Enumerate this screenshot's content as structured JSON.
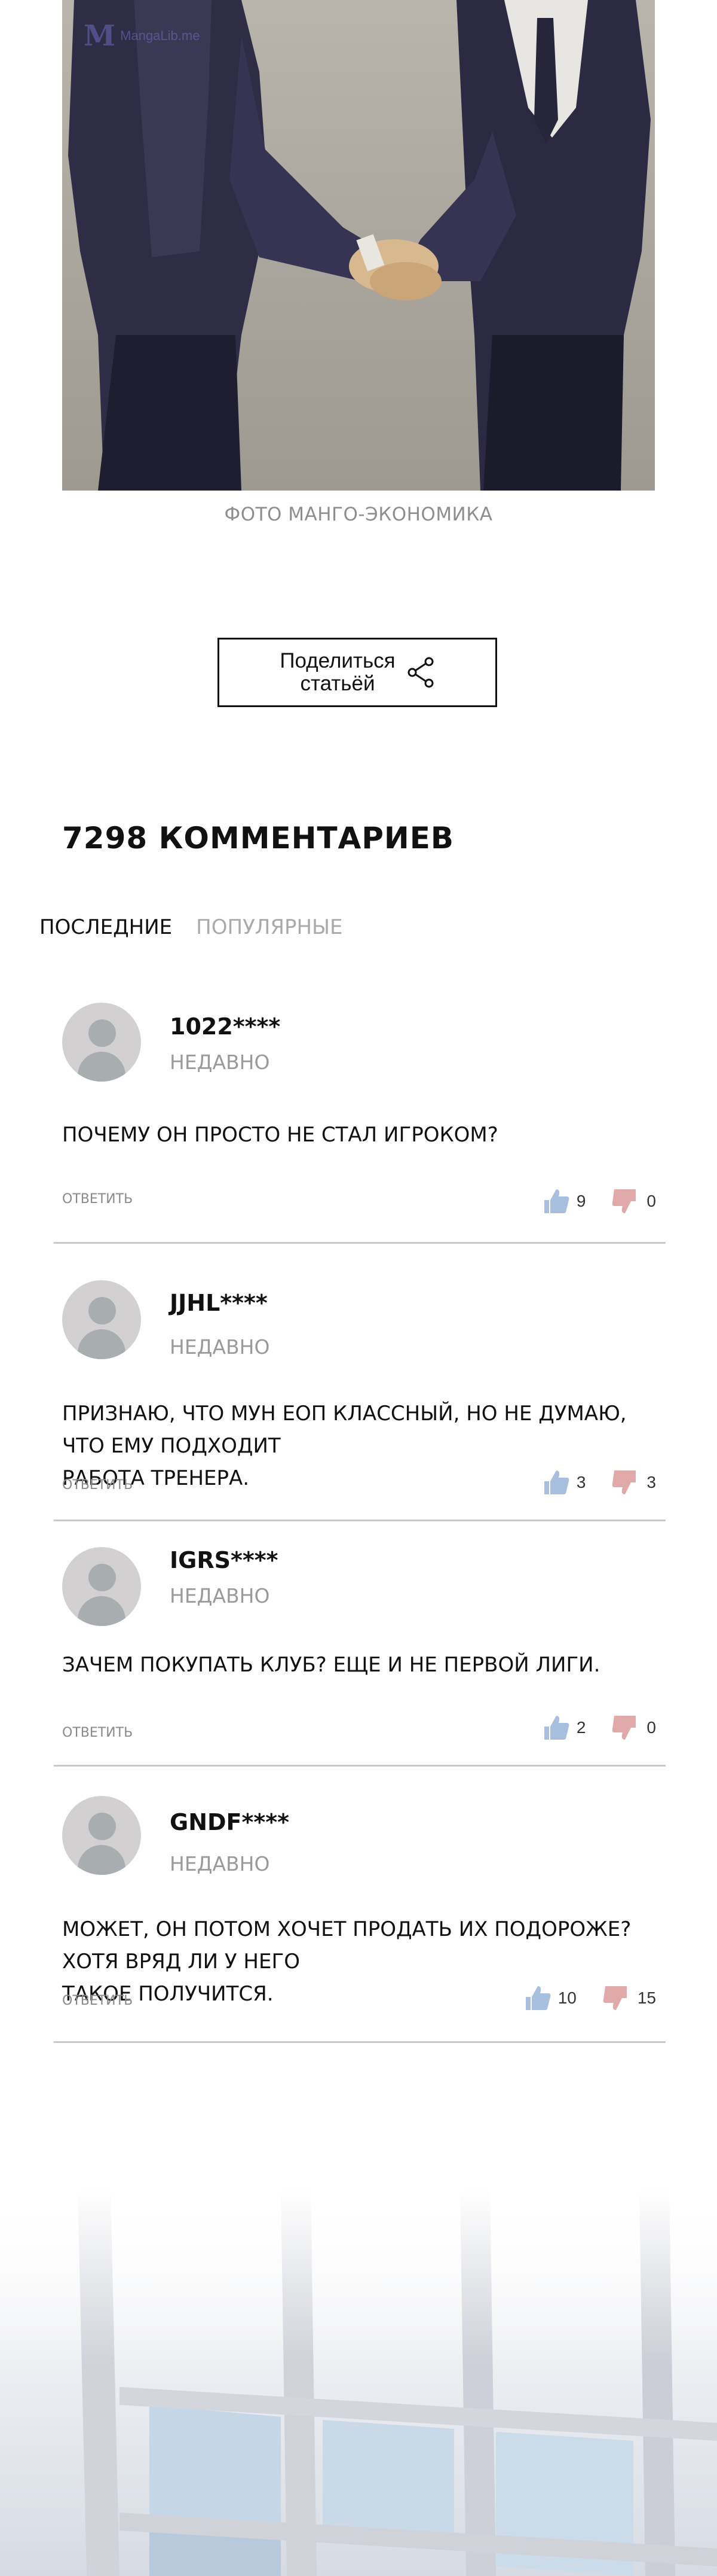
{
  "header_image": {
    "watermark_text": "MangaLib.me",
    "caption": "ФОТО МАНГО-ЭКОНОМИКА"
  },
  "share": {
    "label_line1": "Поделиться",
    "label_line2": "статьёй",
    "icon": "share-icon"
  },
  "comments_section": {
    "count_label": "7298 КОММЕНТАРИЕВ",
    "tabs": [
      {
        "label": "ПОСЛЕДНИЕ",
        "active": true
      },
      {
        "label": "ПОПУЛЯРНЫЕ",
        "active": false
      }
    ],
    "reply_label": "ОТВЕТИТЬ",
    "items": [
      {
        "user": "1022****",
        "time": "НЕДАВНО",
        "text_lines": [
          "ПОЧЕМУ ОН ПРОСТО НЕ СТАЛ ИГРОКОМ?"
        ],
        "likes": "9",
        "dislikes": "0"
      },
      {
        "user": "JJHL****",
        "time": "НЕДАВНО",
        "text_lines": [
          "ПРИЗНАЮ, ЧТО МУН ЕОП КЛАССНЫЙ, НО НЕ ДУМАЮ, ЧТО ЕМУ ПОДХОДИТ",
          "РАБОТА ТРЕНЕРА."
        ],
        "likes": "3",
        "dislikes": "3"
      },
      {
        "user": "IGRS****",
        "time": "НЕДАВНО",
        "text_lines": [
          "ЗАЧЕМ ПОКУПАТЬ КЛУБ? ЕЩЕ И НЕ ПЕРВОЙ ЛИГИ."
        ],
        "likes": "2",
        "dislikes": "0"
      },
      {
        "user": "GNDF****",
        "time": "НЕДАВНО",
        "text_lines": [
          "МОЖЕТ, ОН ПОТОМ ХОЧЕТ ПРОДАТЬ ИХ ПОДОРОЖЕ? ХОТЯ ВРЯД ЛИ У НЕГО",
          "ТАКОЕ ПОЛУЧИТСЯ."
        ],
        "likes": "10",
        "dislikes": "15"
      }
    ]
  },
  "colors": {
    "like": "#a9bfe0",
    "dislike": "#e0aaaa",
    "suit": "#2e2d45",
    "divider": "#c8c8c8"
  }
}
